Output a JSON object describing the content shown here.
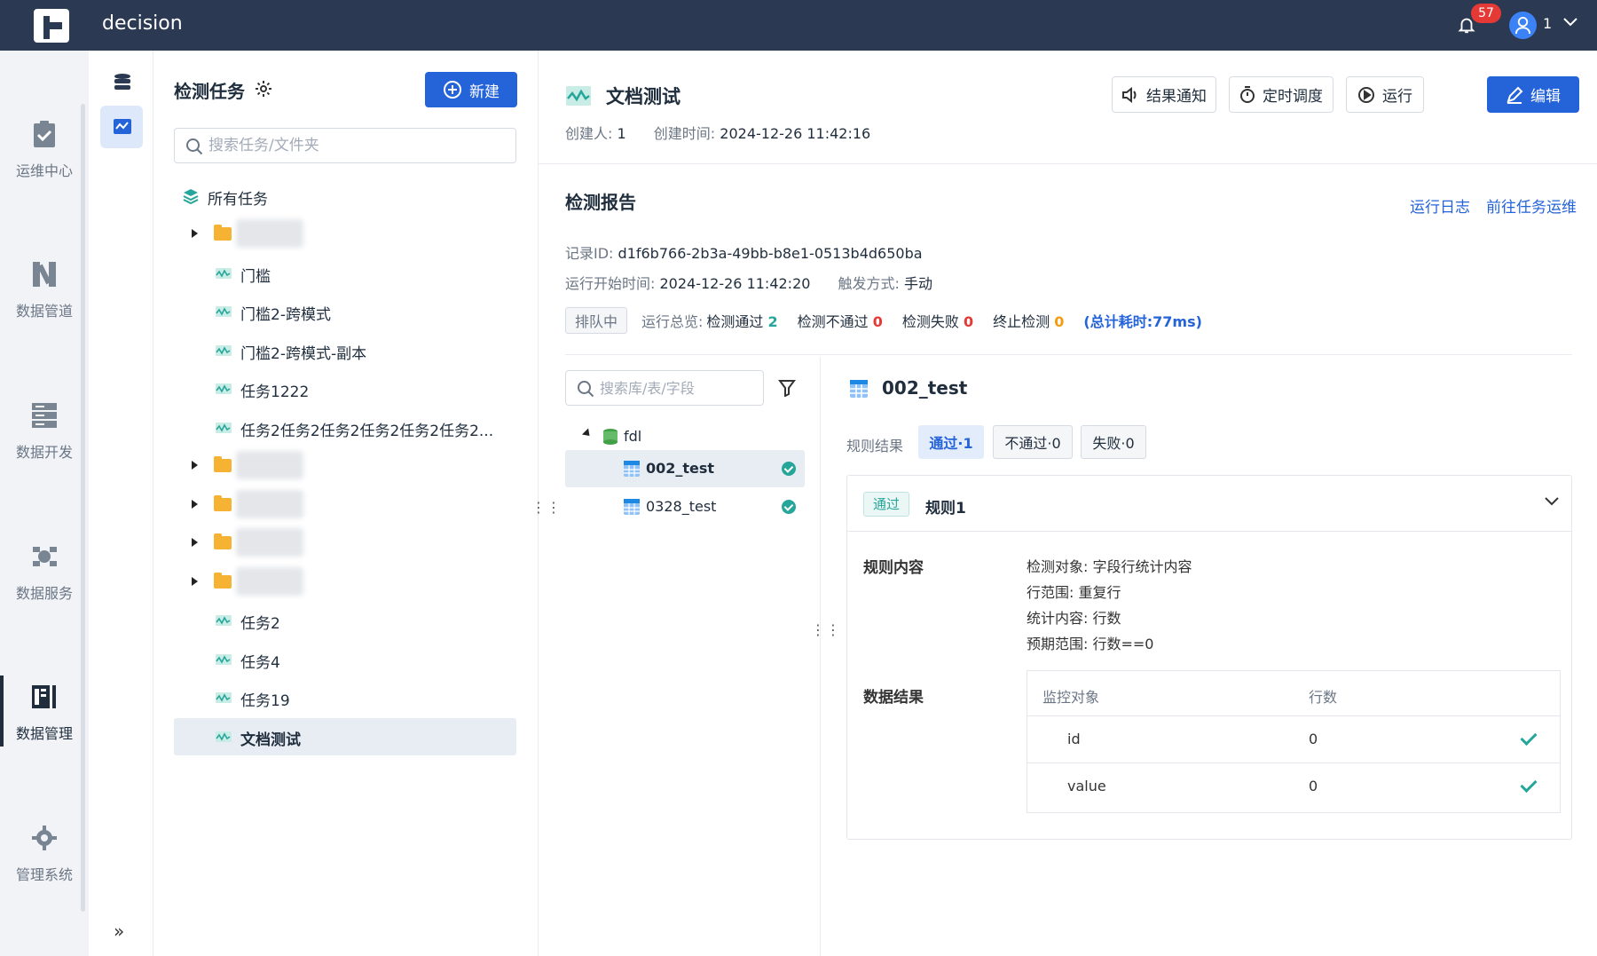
{
  "app": {
    "title": "decision",
    "notif_count": "57",
    "user": "1"
  },
  "nav": {
    "items": [
      {
        "label": "运维中心",
        "icon": "clipboard-check-icon"
      },
      {
        "label": "数据管道",
        "icon": "pipeline-icon"
      },
      {
        "label": "数据开发",
        "icon": "server-rack-icon"
      },
      {
        "label": "数据服务",
        "icon": "api-service-icon"
      },
      {
        "label": "数据管理",
        "icon": "data-management-icon",
        "active": true
      },
      {
        "label": "管理系统",
        "icon": "gear-icon"
      }
    ]
  },
  "tree_panel": {
    "title": "检测任务",
    "new_button": "新建",
    "search_placeholder": "搜索任务/文件夹",
    "root": "所有任务",
    "items": [
      {
        "type": "folder",
        "label": ""
      },
      {
        "type": "task",
        "label": "门槛"
      },
      {
        "type": "task",
        "label": "门槛2-跨模式"
      },
      {
        "type": "task",
        "label": "门槛2-跨模式-副本"
      },
      {
        "type": "task",
        "label": "任务1222"
      },
      {
        "type": "task",
        "label": "任务2任务2任务2任务2任务2任务2..."
      },
      {
        "type": "folder",
        "label": ""
      },
      {
        "type": "folder",
        "label": ""
      },
      {
        "type": "folder",
        "label": ""
      },
      {
        "type": "folder",
        "label": ""
      },
      {
        "type": "task",
        "label": "任务2"
      },
      {
        "type": "task",
        "label": "任务4"
      },
      {
        "type": "task",
        "label": "任务19"
      },
      {
        "type": "task",
        "label": "文档测试",
        "selected": true
      }
    ]
  },
  "header": {
    "title": "文档测试",
    "creator_label": "创建人:",
    "creator": "1",
    "created_label": "创建时间:",
    "created": "2024-12-26 11:42:16",
    "buttons": {
      "notify": "结果通知",
      "schedule": "定时调度",
      "run": "运行",
      "edit": "编辑"
    }
  },
  "report": {
    "title": "检测报告",
    "link_log": "运行日志",
    "link_ops": "前往任务运维",
    "record_label": "记录ID:",
    "record_id": "d1f6b766-2b3a-49bb-b8e1-0513b4d650ba",
    "start_label": "运行开始时间:",
    "start_time": "2024-12-26 11:42:20",
    "trigger_label": "触发方式:",
    "trigger": "手动",
    "queue_tag": "排队中",
    "summary_label": "运行总览:",
    "pass_label": "检测通过",
    "pass_count": "2",
    "fail_label": "检测不通过",
    "fail_count": "0",
    "error_label": "检测失败",
    "error_count": "0",
    "stop_label": "终止检测",
    "stop_count": "0",
    "total_time": "(总计耗时:77ms)"
  },
  "inner_tree": {
    "search_placeholder": "搜索库/表/字段",
    "db": "fdl",
    "tables": [
      {
        "label": "002_test",
        "selected": true,
        "status": "pass"
      },
      {
        "label": "0328_test",
        "selected": false,
        "status": "pass"
      }
    ]
  },
  "detail": {
    "title": "002_test",
    "rule_result_label": "规则结果",
    "pills": [
      "通过·1",
      "不通过·0",
      "失败·0"
    ],
    "rule": {
      "status": "通过",
      "name": "规则1",
      "content_label": "规则内容",
      "content_lines": [
        "检测对象: 字段行统计内容",
        "行范围: 重复行",
        "统计内容: 行数",
        "预期范围: 行数==0"
      ],
      "data_label": "数据结果",
      "table_headers": [
        "监控对象",
        "行数"
      ],
      "rows": [
        {
          "object": "id",
          "count": "0"
        },
        {
          "object": "value",
          "count": "0"
        }
      ]
    }
  }
}
